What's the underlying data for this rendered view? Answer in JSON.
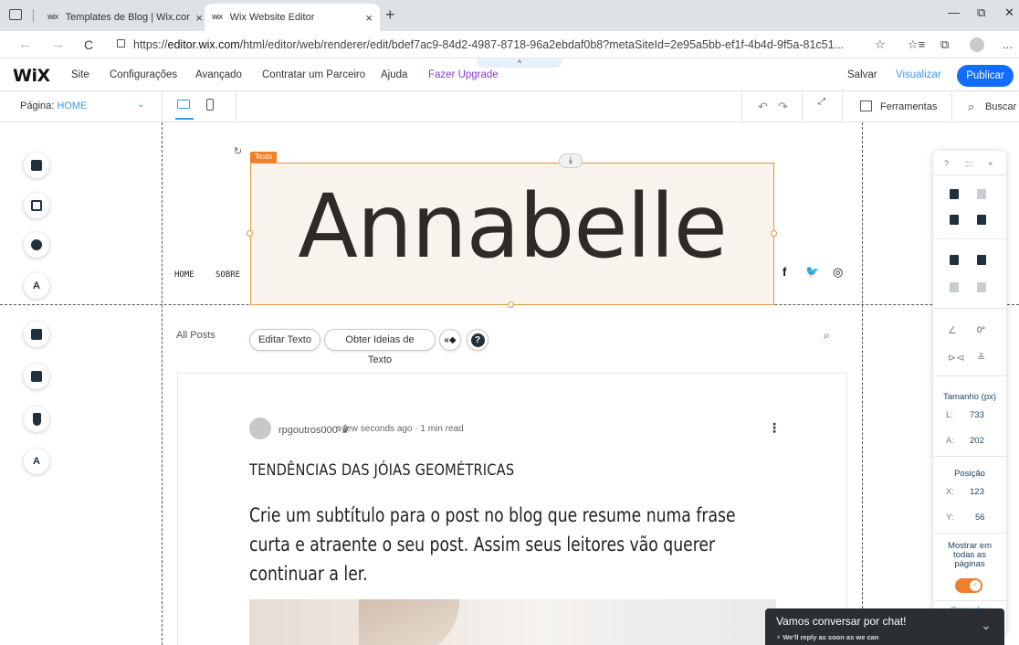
{
  "browser": {
    "tabs": [
      {
        "favicon": "WiX",
        "title": "Templates de Blog | Wix.com",
        "close": "×"
      },
      {
        "favicon": "WiX",
        "title": "Wix Website Editor",
        "close": "×"
      }
    ],
    "new_tab": "+",
    "window_controls": {
      "minimize": "—",
      "maximize": "⧉",
      "close": "✕"
    },
    "nav": {
      "back": "←",
      "forward": "→",
      "reload": "C"
    },
    "url_prefix": "https://",
    "url_host": "editor.wix.com",
    "url_path": "/html/editor/web/renderer/edit/bdef7ac9-84d2-4987-8718-96a2ebdaf0b8?metaSiteId=2e95a5bb-ef1f-4b4d-9f5a-81c51...",
    "toolbar_icons": {
      "favorite": "☆",
      "favorites_bar": "☆≡",
      "collections": "⧉",
      "more": "..."
    }
  },
  "editor_topbar": {
    "logo": "WiX",
    "menu": [
      "Site",
      "Configurações",
      "Avançado",
      "Contratar um Parceiro",
      "Ajuda"
    ],
    "upgrade": "Fazer Upgrade",
    "collapse": "^",
    "save": "Salvar",
    "preview": "Visualizar",
    "publish": "Publicar"
  },
  "editor_subbar": {
    "page_label": "Página: ",
    "page_name": "HOME",
    "chevron": "⌄",
    "undo": "↶",
    "redo": "↷",
    "zoom": "⤢",
    "tools": "Ferramentas",
    "search": "Buscar"
  },
  "left_tools": [
    {
      "name": "pages",
      "label": ""
    },
    {
      "name": "background",
      "label": ""
    },
    {
      "name": "add",
      "label": "+"
    },
    {
      "name": "design",
      "label": "A"
    },
    {
      "name": "apps",
      "label": ""
    },
    {
      "name": "media",
      "label": ""
    },
    {
      "name": "blog",
      "label": ""
    },
    {
      "name": "business",
      "label": "A"
    }
  ],
  "site": {
    "text_tag": "Texto",
    "rotate": "↻",
    "download": "⤓",
    "title": "Annabelle",
    "nav": [
      "HOME",
      "SOBRE"
    ],
    "social": [
      "f",
      "🐦",
      "◎"
    ]
  },
  "blog": {
    "nav_label": "All Posts",
    "edit_text": "Editar Texto",
    "text_ideas": "Obter Ideias de Texto",
    "animation": "«◆",
    "help": "?",
    "search": "⌕",
    "post": {
      "author": "rpgoutros000",
      "crown": "♛",
      "meta": "· a few seconds ago · 1 min read",
      "more": "⋮",
      "title": "TENDÊNCIAS DAS JÓIAS GEOMÉTRICAS",
      "subtitle": "Crie um subtítulo para o post no blog que resume numa frase curta e atraente o seu post. Assim seus leitores vão querer continuar a ler."
    }
  },
  "right_panel": {
    "help": "?",
    "drag": "::::",
    "close": "×",
    "rotation": "0°",
    "size_label": "Tamanho (px)",
    "width_key": "L:",
    "width": "733",
    "height_key": "A:",
    "height": "202",
    "position_label": "Posição",
    "x_key": "X:",
    "x": "123",
    "y_key": "Y:",
    "y": "56",
    "show_all_pages": "Mostrar em todas as páginas",
    "toggle_check": "✓",
    "layers": "Camadas"
  },
  "chat": {
    "title": "Vamos conversar por chat!",
    "subtitle": "⚡ We'll reply as soon as we can",
    "close": "⌄"
  },
  "colors": {
    "wix_blue": "#116dff",
    "link_blue": "#3899ec",
    "upgrade_purple": "#8a3cc9",
    "selection_orange": "#f07e2a",
    "chat_dark": "#2b2f33"
  }
}
